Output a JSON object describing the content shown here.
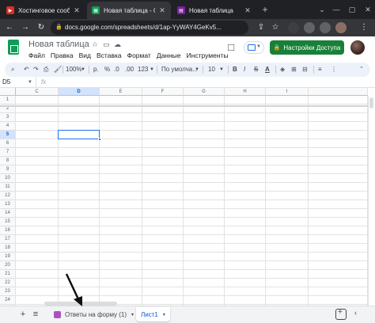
{
  "browser": {
    "tabs": [
      {
        "title": "Хостинговое сообщество",
        "favicon_color": "#d93025",
        "favicon_glyph": "▶"
      },
      {
        "title": "Новая таблица - Goo",
        "favicon_color": "#0f9d58",
        "favicon_glyph": "▦"
      },
      {
        "title": "Новая таблица",
        "favicon_color": "#7b1fa2",
        "favicon_glyph": "▤"
      }
    ],
    "tab_close_glyph": "✕",
    "new_tab_glyph": "+",
    "window_controls": [
      "⌄",
      "—",
      "▢",
      "✕"
    ],
    "nav": {
      "back": "←",
      "forward": "→",
      "reload": "↻"
    },
    "url": "docs.google.com/spreadsheets/d/1ap-YyWAY4GeKv5..."
  },
  "sheets": {
    "title": "Новая таблица",
    "menu": [
      "Файл",
      "Правка",
      "Вид",
      "Вставка",
      "Формат",
      "Данные",
      "Инструменты"
    ],
    "share_label": "Настройки Доступа",
    "brand_color": "#0f9d58",
    "share_color": "#188038",
    "toolbar": {
      "zoom": "100%",
      "currency": "р.",
      "percent": "%",
      "dec_dec": ".0",
      "dec_inc": ".00",
      "format_more": "123",
      "font": "По умолча...",
      "font_size": "10",
      "bold": "B",
      "italic": "I",
      "strike": "S",
      "text_color": "A"
    },
    "name_box": "D5",
    "fx": "fx"
  },
  "grid": {
    "columns": [
      "C",
      "D",
      "E",
      "F",
      "G",
      "H",
      "I"
    ],
    "selected_column": "D",
    "rows": [
      "1",
      "2",
      "3",
      "4",
      "5",
      "6",
      "7",
      "8",
      "9",
      "10",
      "11",
      "12",
      "13",
      "14",
      "15",
      "16",
      "17",
      "18",
      "19",
      "20",
      "21",
      "22",
      "23",
      "24",
      "25"
    ],
    "selected_row": "5",
    "selected_cell": "D5"
  },
  "bottom": {
    "add_sheet": "+",
    "all_sheets": "≡",
    "sheet_tabs": [
      {
        "label": "Ответы на форму (1)"
      },
      {
        "label": "Лист1"
      }
    ],
    "caret": "▾",
    "collapse": "‹"
  }
}
